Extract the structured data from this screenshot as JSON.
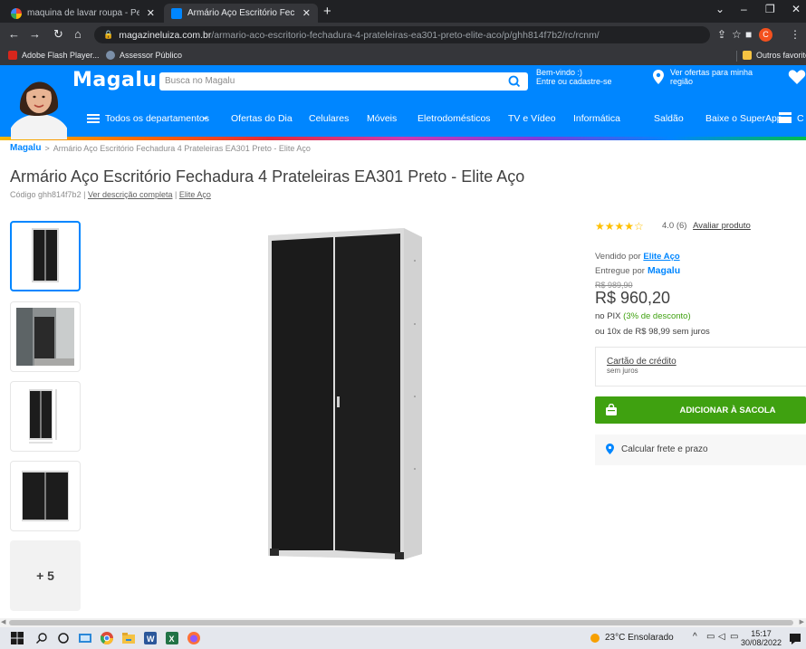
{
  "browser": {
    "tabs": [
      {
        "title": "maquina de lavar roupa - Pesqui",
        "active": false
      },
      {
        "title": "Armário Aço Escritório Fechadur",
        "active": true
      }
    ],
    "url_domain": "magazineluiza.com.br",
    "url_path": "/armario-aco-escritorio-fechadura-4-prateleiras-ea301-preto-elite-aco/p/ghh814f7b2/rc/rcnm/",
    "profile_initial": "C",
    "bookmarks": [
      "Adobe Flash Player...",
      "Assessor Público"
    ],
    "other_bookmarks": "Outros favoritos"
  },
  "header": {
    "logo": "Magalu",
    "search_placeholder": "Busca no Magalu",
    "welcome_line1": "Bem-vindo :)",
    "welcome_line2": "Entre ou cadastre-se",
    "offers_line1": "Ver ofertas para minha",
    "offers_line2": "região",
    "nav": [
      "Todos os departamentos",
      "Ofertas do Dia",
      "Celulares",
      "Móveis",
      "Eletrodomésticos",
      "TV e Vídeo",
      "Informática",
      "Saldão",
      "Baixe o SuperApp",
      "C"
    ]
  },
  "breadcrumb": {
    "logo": "Magalu",
    "separator": ">",
    "current": "Armário Aço Escritório Fechadura 4 Prateleiras EA301 Preto - Elite Aço"
  },
  "product": {
    "title": "Armário Aço Escritório Fechadura 4 Prateleiras EA301 Preto - Elite Aço",
    "code_label": "Código ghh814f7b2",
    "description_link": "Ver descrição completa",
    "brand_link": "Elite Aço",
    "more_images": "+ 5",
    "rating": 4.0,
    "stars": "★★★★☆",
    "rating_text": "4.0 (6)",
    "rate_link": "Avaliar produto",
    "sold_by_label": "Vendido por",
    "seller": "Elite Aço",
    "delivered_by_label": "Entregue por",
    "delivered_by": "Magalu",
    "old_price": "R$ 989,90",
    "price": "R$ 960,20",
    "pix_label": "no PIX",
    "pix_discount": "(3% de desconto)",
    "installments": "ou 10x de R$ 98,99 sem juros",
    "card_title": "Cartão de crédito",
    "card_sub": "sem juros",
    "add_button": "ADICIONAR À SACOLA",
    "freight_label": "Calcular frete e prazo"
  },
  "taskbar": {
    "weather": "23°C  Ensolarado",
    "time": "15:17",
    "date": "30/08/2022"
  },
  "colors": {
    "brand_blue": "#0086ff",
    "buy_green": "#3fa110",
    "star": "#ffc000"
  }
}
